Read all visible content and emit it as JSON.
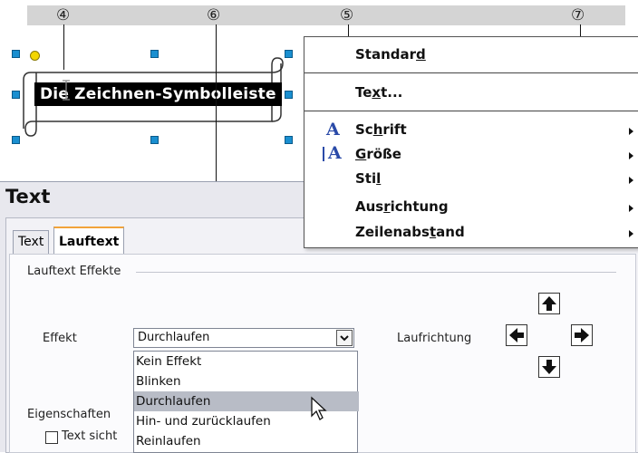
{
  "callouts": [
    "④",
    "⑥",
    "⑤",
    "⑦"
  ],
  "shape": {
    "text": "Die Zeichnen-Symbolleiste"
  },
  "context_menu": {
    "items": [
      {
        "pre": "Standar",
        "key": "d",
        "post": ""
      },
      {
        "pre": "Te",
        "key": "x",
        "post": "t..."
      },
      {
        "pre": "Sc",
        "key": "h",
        "post": "rift"
      },
      {
        "pre": "",
        "key": "G",
        "post": "röße"
      },
      {
        "pre": "Sti",
        "key": "l",
        "post": ""
      },
      {
        "pre": "Aus",
        "key": "r",
        "post": "ichtung"
      },
      {
        "pre": "Zeilenabs",
        "key": "t",
        "post": "and"
      }
    ],
    "font_icon": "A"
  },
  "dialog": {
    "title": "Text",
    "tabs": [
      "Text",
      "Lauftext"
    ],
    "group_effects": "Lauftext Effekte",
    "effect_label": "Effekt",
    "effect_value": "Durchlaufen",
    "direction_label": "Laufrichtung",
    "group_properties": "Eigenschaften",
    "checkbox_text": "Text sicht"
  },
  "dropdown": {
    "options": [
      "Kein Effekt",
      "Blinken",
      "Durchlaufen",
      "Hin- und zurücklaufen",
      "Reinlaufen"
    ],
    "selected_index": 2
  },
  "colors": {
    "accent_tab": "#f2a33a",
    "handle": "#1a8fd0",
    "font_icon": "#2a4aa8"
  }
}
